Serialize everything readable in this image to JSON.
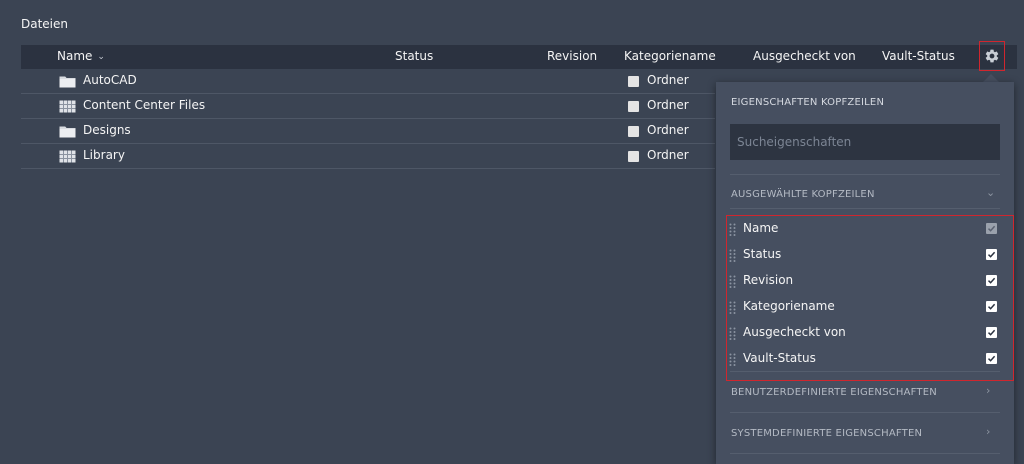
{
  "page": {
    "title": "Dateien"
  },
  "table": {
    "columns": [
      {
        "label": "Name",
        "sortable": true
      },
      {
        "label": "Status"
      },
      {
        "label": "Revision"
      },
      {
        "label": "Kategoriename"
      },
      {
        "label": "Ausgecheckt von"
      },
      {
        "label": "Vault-Status"
      }
    ],
    "rows": [
      {
        "name": "AutoCAD",
        "icon": "folder-icon",
        "category": "Ordner"
      },
      {
        "name": "Content Center Files",
        "icon": "library-icon",
        "category": "Ordner"
      },
      {
        "name": "Designs",
        "icon": "folder-icon",
        "category": "Ordner"
      },
      {
        "name": "Library",
        "icon": "library-icon",
        "category": "Ordner"
      }
    ]
  },
  "toolbar": {
    "settings_icon": "gear-icon"
  },
  "panel": {
    "heading": "EIGENSCHAFTEN KOPFZEILEN",
    "search_placeholder": "Sucheigenschaften",
    "selected_section": "AUSGEWÄHLTE KOPFZEILEN",
    "selected": [
      {
        "label": "Name",
        "checked": true,
        "disabled": true
      },
      {
        "label": "Status",
        "checked": true
      },
      {
        "label": "Revision",
        "checked": true
      },
      {
        "label": "Kategoriename",
        "checked": true
      },
      {
        "label": "Ausgecheckt von",
        "checked": true
      },
      {
        "label": "Vault-Status",
        "checked": true
      }
    ],
    "custom_section": "BENUTZERDEFINIERTE EIGENSCHAFTEN",
    "system_section": "SYSTEMDEFINIERTE EIGENSCHAFTEN"
  },
  "colors": {
    "background": "#3b4453",
    "header": "#2b3240",
    "panel": "#464f60",
    "highlight": "#d0262e"
  }
}
